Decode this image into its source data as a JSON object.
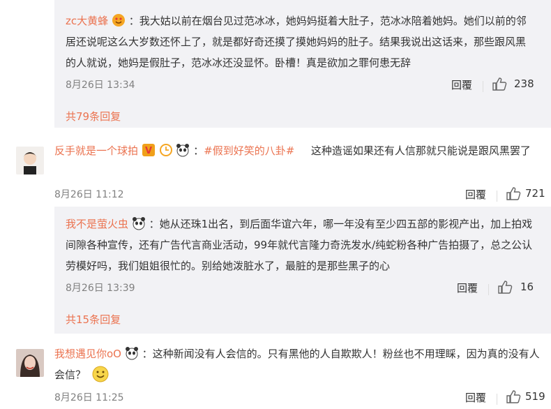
{
  "c0": {
    "author": "zc大黄蜂",
    "text": "：我大姑以前在烟台见过范冰冰，她妈妈挺着大肚子，范冰冰陪着她妈。她们以前的邻居还说呢这么大岁数还怀上了，就是都好奇还摸了摸她妈妈的肚子。结果我说出这话来，那些跟风黑的人就说，她妈是假肚子，范冰冰还没显怀。卧槽！真是欲加之罪何患无辞",
    "time": "8月26日 13:34",
    "reply": "回覆",
    "likes": "238",
    "more": "共79条回复"
  },
  "c1": {
    "author": "反手就是一个球拍",
    "topic": "#假到好笑的八卦#",
    "text": "这种造谣如果还有人信那就只能说是跟风黑罢了",
    "time": "8月26日 11:12",
    "reply": "回覆",
    "likes": "721",
    "badge": "V"
  },
  "c1r": {
    "author": "我不是萤火虫",
    "text": "：她从还珠1出名，到后面华谊六年，哪一年没有至少四五部的影视产出，加上拍戏间隙各种宣传，还有广告代言商业活动，99年就代言隆力奇洗发水/纯蛇粉各种广告拍摄了，总之公认劳模好吗，我们姐姐很忙的。别给她泼脏水了，最脏的是那些黑子的心",
    "time": "8月26日 13:39",
    "reply": "回覆",
    "likes": "16",
    "more": "共15条回复"
  },
  "c2": {
    "author": "我想遇见你oO",
    "text": "：这种新闻没有人会信的。只有黑他的人自欺欺人！粉丝也不用理睬，因为真的没有人会信？",
    "time": "8月26日 11:25",
    "reply": "回覆",
    "likes": "519"
  }
}
